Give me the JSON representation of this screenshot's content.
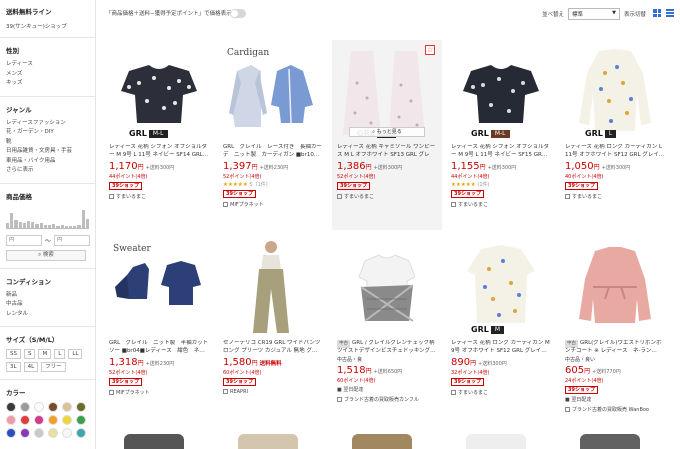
{
  "sidebar": {
    "title": "送料無料ライン",
    "subtitle": "39(サンキュー)ショップ",
    "gender": {
      "heading": "性別",
      "items": [
        "レディース",
        "メンズ",
        "キッズ"
      ]
    },
    "genre": {
      "heading": "ジャンル",
      "items": [
        "レディースファッション",
        "花・ガーデン・DIY",
        "靴",
        "日用品雑貨・文房具・手芸",
        "車用品・バイク用品",
        "さらに表示"
      ]
    },
    "price": {
      "heading": "商品価格",
      "min_placeholder": "円",
      "max_placeholder": "円",
      "tilde": "〜",
      "search_label": "検索"
    },
    "condition": {
      "heading": "コンディション",
      "items": [
        "新品",
        "中古品",
        "レンタル"
      ]
    },
    "size": {
      "heading": "サイズ（S/M/L）",
      "items": [
        "SS",
        "S",
        "M",
        "L",
        "LL",
        "3L",
        "4L",
        "フリー"
      ]
    },
    "color": {
      "heading": "カラー",
      "swatches": [
        "#3a3a3a",
        "#9a9a9a",
        "#ffffff",
        "#7a4a2a",
        "#d9c49a",
        "#6b6b2a",
        "#f29aa3",
        "#e33b3b",
        "#d23a8c",
        "#f0a02a",
        "#efd53a",
        "#3aa14a",
        "#2a4fc2",
        "#8a3ab8",
        "#c9c9c9",
        "#e8e0a0",
        "#f7f7f7",
        "#38a8a8"
      ]
    }
  },
  "topbar": {
    "toggle_label": "「商品価格＋送料−獲得予定ポイント」で価格表示",
    "sort_label": "並べ替え",
    "sort_value": "標準",
    "view_label": "表示切替"
  },
  "products": [
    {
      "name": "レディース 花柄 シフォン オフショルダー M 9号 L 11号 ネイビー SF14 GRL…",
      "price": "1,170",
      "yen": "円",
      "ship": "+送料300円",
      "points": "44ポイント(4倍)",
      "stars": "",
      "reviews": "",
      "badge": "39ショップ",
      "shop": "すまいるまこ",
      "brand": "GRL",
      "brand_size": "M-L",
      "cond": "",
      "ship_free": "",
      "delivery": ""
    },
    {
      "name": "GRL　グレイル　レース付き　長袖カーデ　ニット製　カーディガン ■br10…",
      "price": "1,397",
      "yen": "円",
      "ship": "+送料230円",
      "points": "52ポイント(4倍)",
      "stars": "★★★★★",
      "reviews": "5（1件）",
      "badge": "39ショップ",
      "shop": "MIFプラネット",
      "brand": "Cardigan",
      "brand_size": "",
      "cond": "",
      "ship_free": "",
      "delivery": ""
    },
    {
      "name": "レディース 花柄 キャミソール ワンピース M L オフホワイト SF13 GRL グレー…",
      "price": "1,386",
      "yen": "円",
      "ship": "+送料300円",
      "points": "52ポイント(4倍)",
      "stars": "",
      "reviews": "",
      "badge": "39ショップ",
      "shop": "すまいるまこ",
      "brand": "GRL",
      "brand_size": "M-L",
      "cond": "",
      "ship_free": "",
      "delivery": "",
      "more": "もっと見る"
    },
    {
      "name": "レディース 花柄 シフォン オフショルダー M 9号 L 11号 ネイビー SF15 GR…",
      "price": "1,155",
      "yen": "円",
      "ship": "+送料300円",
      "points": "44ポイント(4倍)",
      "stars": "★★★★★",
      "reviews": "(1件)",
      "badge": "39ショップ",
      "shop": "すまいるまこ",
      "brand": "GRL",
      "brand_size": "M-L",
      "cond": "",
      "ship_free": "",
      "delivery": ""
    },
    {
      "name": "レディース 花柄 ロング カーディガン L 11号 オフホワイト SF12 GRL グレイ…",
      "price": "1,050",
      "yen": "円",
      "ship": "+送料300円",
      "points": "40ポイント(4倍)",
      "stars": "",
      "reviews": "",
      "badge": "39ショップ",
      "shop": "すまいるまこ",
      "brand": "GRL",
      "brand_size": "L",
      "cond": "",
      "ship_free": "",
      "delivery": ""
    },
    {
      "name": "GRL　グレイル　ニット製　半袖カットソー ■br04■レディース　紺色　ネ…",
      "price": "1,318",
      "yen": "円",
      "ship": "+送料230円",
      "points": "52ポイント(4倍)",
      "stars": "",
      "reviews": "",
      "badge": "39ショップ",
      "shop": "MIFプラネット",
      "brand": "Sweater",
      "brand_size": "",
      "cond": "",
      "ship_free": "",
      "delivery": ""
    },
    {
      "name": "セノーテリコ CR19 GRL ワイドパンツ ロング プリーツ カジュアル 無地 グ…",
      "price": "1,580",
      "yen": "円",
      "ship": "",
      "points": "60ポイント(4倍)",
      "stars": "",
      "reviews": "",
      "badge": "39ショップ",
      "shop": "REAPRI",
      "brand": "",
      "brand_size": "",
      "cond": "",
      "ship_free": "送料無料",
      "delivery": ""
    },
    {
      "name": "GRL / グレイルグレンチェック柄ツイストデザインビスチェドッキング…",
      "price": "1,518",
      "yen": "円",
      "ship": "+送料650円",
      "points": "60ポイント(4倍)",
      "stars": "",
      "reviews": "",
      "badge": "",
      "shop": "ブランド古着の買取販売カンフル",
      "brand": "",
      "brand_size": "",
      "cond": "中古",
      "cond_note": "中古品・良",
      "ship_free": "",
      "delivery": "翌日配達"
    },
    {
      "name": "レディース 花柄 ロング カーディガン M 9号 オフホワイト SF12 GRL グレイ…",
      "price": "890",
      "yen": "円",
      "ship": "+送料300円",
      "points": "32ポイント(4倍)",
      "stars": "",
      "reviews": "",
      "badge": "39ショップ",
      "shop": "すまいるまこ",
      "brand": "GRL",
      "brand_size": "M",
      "cond": "",
      "ship_free": "",
      "delivery": ""
    },
    {
      "name": "GRL(グレイル)ウエストリボンボンチコート ※ レディース　ネ-ラン…",
      "price": "605",
      "yen": "円",
      "ship": "+送料770円",
      "points": "24ポイント(4倍)",
      "stars": "",
      "reviews": "",
      "badge": "39ショップ",
      "shop": "ブランド古着の買取販売 WanBoo",
      "brand": "",
      "brand_size": "",
      "cond": "中古",
      "cond_note": "中古品・良い",
      "ship_free": "",
      "delivery": "翌日配達"
    }
  ]
}
